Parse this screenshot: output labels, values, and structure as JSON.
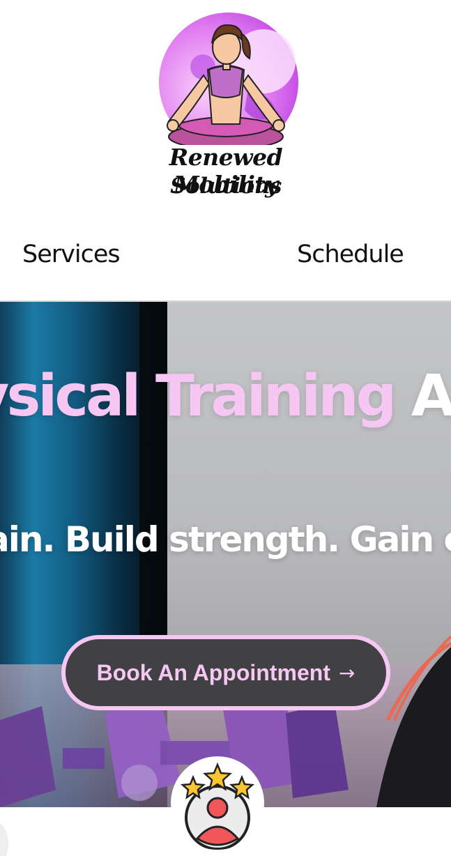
{
  "brand": {
    "name_line1": "Renewed Mobility",
    "name_line2": "Solutions"
  },
  "nav": {
    "items": [
      {
        "label": "Services"
      },
      {
        "label": "Schedule"
      }
    ]
  },
  "hero": {
    "title_highlight": "ysical Training",
    "title_rest": "Ap",
    "subtitle": "ain. Build strength. Gain con",
    "cta_label": "Book An Appointment",
    "cta_icon": "arrow-right-icon"
  },
  "badge": {
    "icon": "review-stars-icon"
  },
  "colors": {
    "accent_pink": "#f6c7f2",
    "button_dark": "#414042",
    "logo_purple": "#c23fe0",
    "dumbbell_purple": "#8a55b8"
  }
}
